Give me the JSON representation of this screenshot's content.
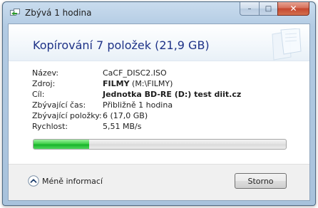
{
  "window": {
    "title": "Zbývá 1 hodina",
    "minimize_glyph": "–",
    "maximize_glyph": "□",
    "close_glyph": "✕"
  },
  "heading": "Kopírování 7 položek (21,9 GB)",
  "details": {
    "name_label": "Název:",
    "name_value": "CaCF_DISC2.ISO",
    "source_label": "Zdroj:",
    "source_bold": "FILMY",
    "source_rest": " (M:\\FILMY)",
    "target_label": "Cíl:",
    "target_value": "Jednotka BD-RE (D:) test diit.cz",
    "time_label": "Zbývající čas:",
    "time_value": "Přibližně 1 hodina",
    "items_label": "Zbývající položky:",
    "items_value": "6 (17,0 GB)",
    "speed_label": "Rychlost:",
    "speed_value": "5,51 MB/s"
  },
  "progress": {
    "fraction": 0.22
  },
  "footer": {
    "more_info_label": "Méně informací",
    "stop_label": "Storno"
  },
  "colors": {
    "heading": "#1e3287",
    "progress_green": "#17b32a"
  },
  "icons": {
    "title": "copy-icon",
    "more": "chevron-up-icon"
  }
}
